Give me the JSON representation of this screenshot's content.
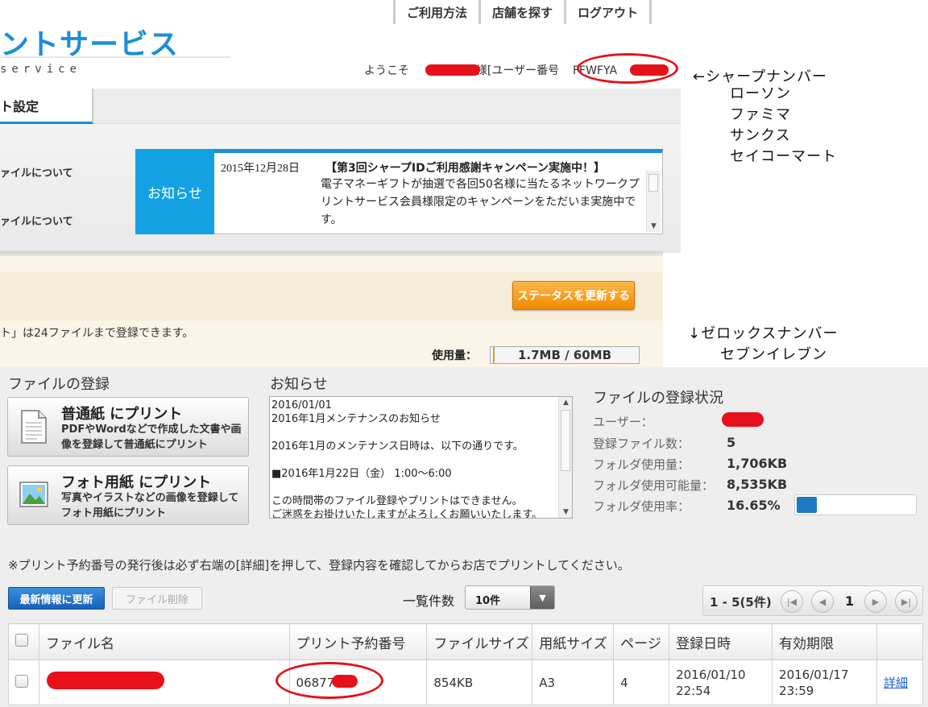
{
  "sharp": {
    "nav": {
      "usage": "ご利用方法",
      "find_store": "店舗を探す",
      "logout": "ログアウト"
    },
    "logo_text": "ントサービス",
    "logo_sub": "service",
    "welcome": {
      "prefix": "ようこそ",
      "suffix": "様[ユーザー番号",
      "user_no": "FFWFYA",
      "close": "]"
    },
    "tab_settings": "ト設定",
    "side_links": [
      "ァイルについて",
      "ァイルについて"
    ],
    "notice": {
      "label": "お知らせ",
      "date": "2015年12月28日",
      "title": "【第3回シャープIDご利用感謝キャンペーン実施中！】",
      "body": "電子マネーギフトが抽選で各回50名様に当たるネットワークプリントサービス会員様限定のキャンペーンをただいま実施中です。"
    },
    "status_button": "ステータスを更新する",
    "limit_text": "ト」は24ファイルまで登録できます。",
    "usage": {
      "label": "使用量：",
      "value": "1.7MB / 60MB",
      "fraction": 0.028
    }
  },
  "annotations": {
    "sharp_arrow": "←シャープナンバー",
    "sharp_stores": [
      "ローソン",
      "ファミマ",
      "サンクス",
      "セイコーマート"
    ],
    "xerox_arrow": "↓ゼロックスナンバー",
    "xerox_stores": [
      "セブンイレブン"
    ]
  },
  "xerox": {
    "register_title": "ファイルの登録",
    "plain_print": {
      "title": "普通紙 にプリント",
      "desc": "PDFやWordなどで作成した文書や画像を登録して普通紙にプリント",
      "icon": "document-icon"
    },
    "photo_print": {
      "title": "フォト用紙 にプリント",
      "desc": "写真やイラストなどの画像を登録してフォト用紙にプリント",
      "icon": "photo-icon"
    },
    "news_title": "お知らせ",
    "news_lines": [
      "2016/01/01",
      "2016年1月メンテナンスのお知らせ",
      "",
      "2016年1月のメンテナンス日時は、以下の通りです。",
      "",
      "■2016年1月22日（金） 1:00～6:00",
      "",
      "この時間帯のファイル登録やプリントはできません。",
      "ご迷惑をお掛けいたしますがよろしくお願いいたします。"
    ],
    "status_title": "ファイルの登録状況",
    "status": {
      "user_label": "ユーザー：",
      "files_label": "登録ファイル数：",
      "files_value": "5",
      "used_label": "フォルダ使用量：",
      "used_value": "1,706KB",
      "avail_label": "フォルダ使用可能量：",
      "avail_value": "8,535KB",
      "rate_label": "フォルダ使用率：",
      "rate_value": "16.65%",
      "rate_fraction": 0.1665
    },
    "warning": "※プリント予約番号の発行後は必ず右端の[詳細]を押して、登録内容を確認してからお店でプリントしてください。",
    "refresh_button": "最新情報に更新",
    "delete_button": "ファイル削除",
    "per_page_label": "一覧件数",
    "per_page_value": "10件",
    "pager": {
      "range": "1 - 5(5件)",
      "current": "1"
    },
    "table": {
      "headers": [
        "ファイル名",
        "プリント予約番号",
        "ファイルサイズ",
        "用紙サイズ",
        "ページ",
        "登録日時",
        "有効期限"
      ],
      "rows": [
        {
          "reservation": "06877",
          "size": "854KB",
          "paper": "A3",
          "pages": "4",
          "registered_date": "2016/01/10",
          "registered_time": "22:54",
          "expires_date": "2016/01/17",
          "expires_time": "23:59",
          "detail": "詳細"
        }
      ]
    }
  },
  "colors": {
    "sharp_blue": "#1a8fd8",
    "redaction": "#e8101a",
    "orange": "#f08a00",
    "xerox_blue": "#1c7ac2"
  }
}
